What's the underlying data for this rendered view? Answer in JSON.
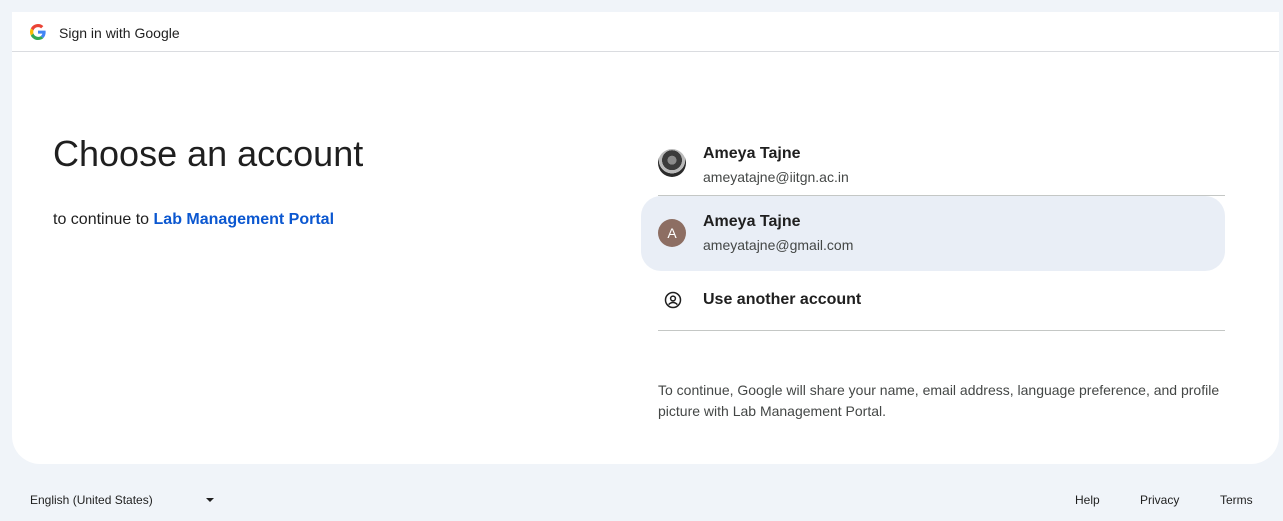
{
  "header": {
    "title": "Sign in with Google",
    "logo_icon": "google-g-icon"
  },
  "main": {
    "heading": "Choose an account",
    "subheading_prefix": "to continue to",
    "app_name": "Lab Management Portal"
  },
  "accounts": [
    {
      "name": "Ameya Tajne",
      "email": "ameyatajne@iitgn.ac.in",
      "avatar_type": "photo"
    },
    {
      "name": "Ameya Tajne",
      "email": "ameyatajne@gmail.com",
      "avatar_type": "letter",
      "avatar_letter": "A",
      "avatar_color": "#8d6e63",
      "highlighted": true
    }
  ],
  "use_another": {
    "label": "Use another account",
    "icon": "account-circle-icon"
  },
  "notice": "To continue, Google will share your name, email address, language preference, and profile picture with Lab Management Portal.",
  "footer": {
    "language": "English (United States)",
    "links": [
      "Help",
      "Privacy",
      "Terms"
    ]
  },
  "colors": {
    "link": "#0b57d0",
    "background": "#f0f4f9",
    "hover_row": "#e9eef6"
  }
}
